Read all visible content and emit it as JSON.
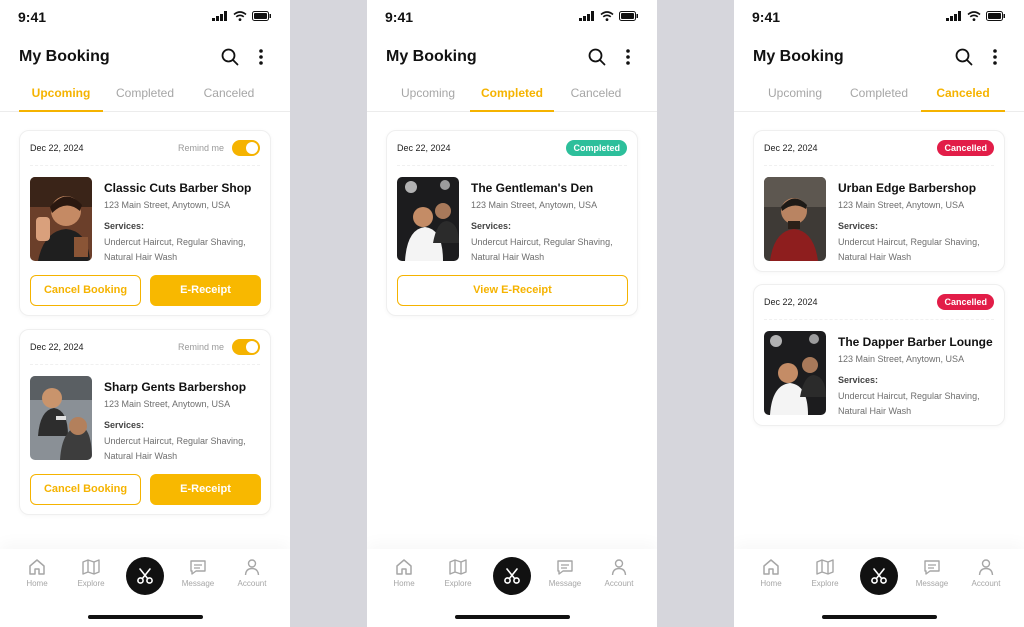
{
  "colors": {
    "accent": "#f5b300",
    "completed": "#2dbf9b",
    "cancelled": "#e21d48",
    "gap": "#d6d6dc"
  },
  "screens": [
    {
      "status": {
        "time": "9:41"
      },
      "header": {
        "title": "My Booking"
      },
      "tabs": [
        {
          "label": "Upcoming"
        },
        {
          "label": "Completed"
        },
        {
          "label": "Canceled"
        }
      ],
      "active_tab": "Upcoming",
      "bookings": [
        {
          "date": "Dec 22, 2024",
          "remind_label": "Remind me",
          "remind_on": true,
          "name": "Classic Cuts Barber Shop",
          "address": "123 Main Street, Anytown, USA",
          "services_label": "Services:",
          "services": "Undercut Haircut, Regular Shaving, Natural Hair Wash",
          "actions": {
            "cancel": "Cancel Booking",
            "receipt": "E-Receipt"
          }
        },
        {
          "date": "Dec 22, 2024",
          "remind_label": "Remind me",
          "remind_on": true,
          "name": "Sharp Gents Barbershop",
          "address": "123 Main Street, Anytown, USA",
          "services_label": "Services:",
          "services": "Undercut Haircut, Regular Shaving, Natural Hair Wash",
          "actions": {
            "cancel": "Cancel Booking",
            "receipt": "E-Receipt"
          }
        }
      ],
      "nav": [
        {
          "label": "Home",
          "icon": "home-icon"
        },
        {
          "label": "Explore",
          "icon": "map-icon"
        },
        {
          "label": "",
          "icon": "scissors-icon"
        },
        {
          "label": "Message",
          "icon": "message-icon"
        },
        {
          "label": "Account",
          "icon": "user-icon"
        }
      ]
    },
    {
      "status": {
        "time": "9:41"
      },
      "header": {
        "title": "My Booking"
      },
      "tabs": [
        {
          "label": "Upcoming"
        },
        {
          "label": "Completed"
        },
        {
          "label": "Canceled"
        }
      ],
      "active_tab": "Completed",
      "bookings": [
        {
          "date": "Dec 22, 2024",
          "badge": "Completed",
          "name": "The Gentleman's Den",
          "address": "123 Main Street, Anytown, USA",
          "services_label": "Services:",
          "services": "Undercut Haircut, Regular Shaving, Natural Hair Wash",
          "actions": {
            "view_receipt": "View E-Receipt"
          }
        }
      ],
      "nav": [
        {
          "label": "Home",
          "icon": "home-icon"
        },
        {
          "label": "Explore",
          "icon": "map-icon"
        },
        {
          "label": "",
          "icon": "scissors-icon"
        },
        {
          "label": "Message",
          "icon": "message-icon"
        },
        {
          "label": "Account",
          "icon": "user-icon"
        }
      ]
    },
    {
      "status": {
        "time": "9:41"
      },
      "header": {
        "title": "My Booking"
      },
      "tabs": [
        {
          "label": "Upcoming"
        },
        {
          "label": "Completed"
        },
        {
          "label": "Canceled"
        }
      ],
      "active_tab": "Canceled",
      "bookings": [
        {
          "date": "Dec 22, 2024",
          "badge": "Cancelled",
          "name": "Urban Edge Barbershop",
          "address": "123 Main Street, Anytown, USA",
          "services_label": "Services:",
          "services": "Undercut Haircut, Regular Shaving, Natural Hair Wash"
        },
        {
          "date": "Dec 22, 2024",
          "badge": "Cancelled",
          "name": "The Dapper Barber Lounge",
          "address": "123 Main Street, Anytown, USA",
          "services_label": "Services:",
          "services": "Undercut Haircut, Regular Shaving, Natural Hair Wash"
        }
      ],
      "nav": [
        {
          "label": "Home",
          "icon": "home-icon"
        },
        {
          "label": "Explore",
          "icon": "map-icon"
        },
        {
          "label": "",
          "icon": "scissors-icon"
        },
        {
          "label": "Message",
          "icon": "message-icon"
        },
        {
          "label": "Account",
          "icon": "user-icon"
        }
      ]
    }
  ]
}
